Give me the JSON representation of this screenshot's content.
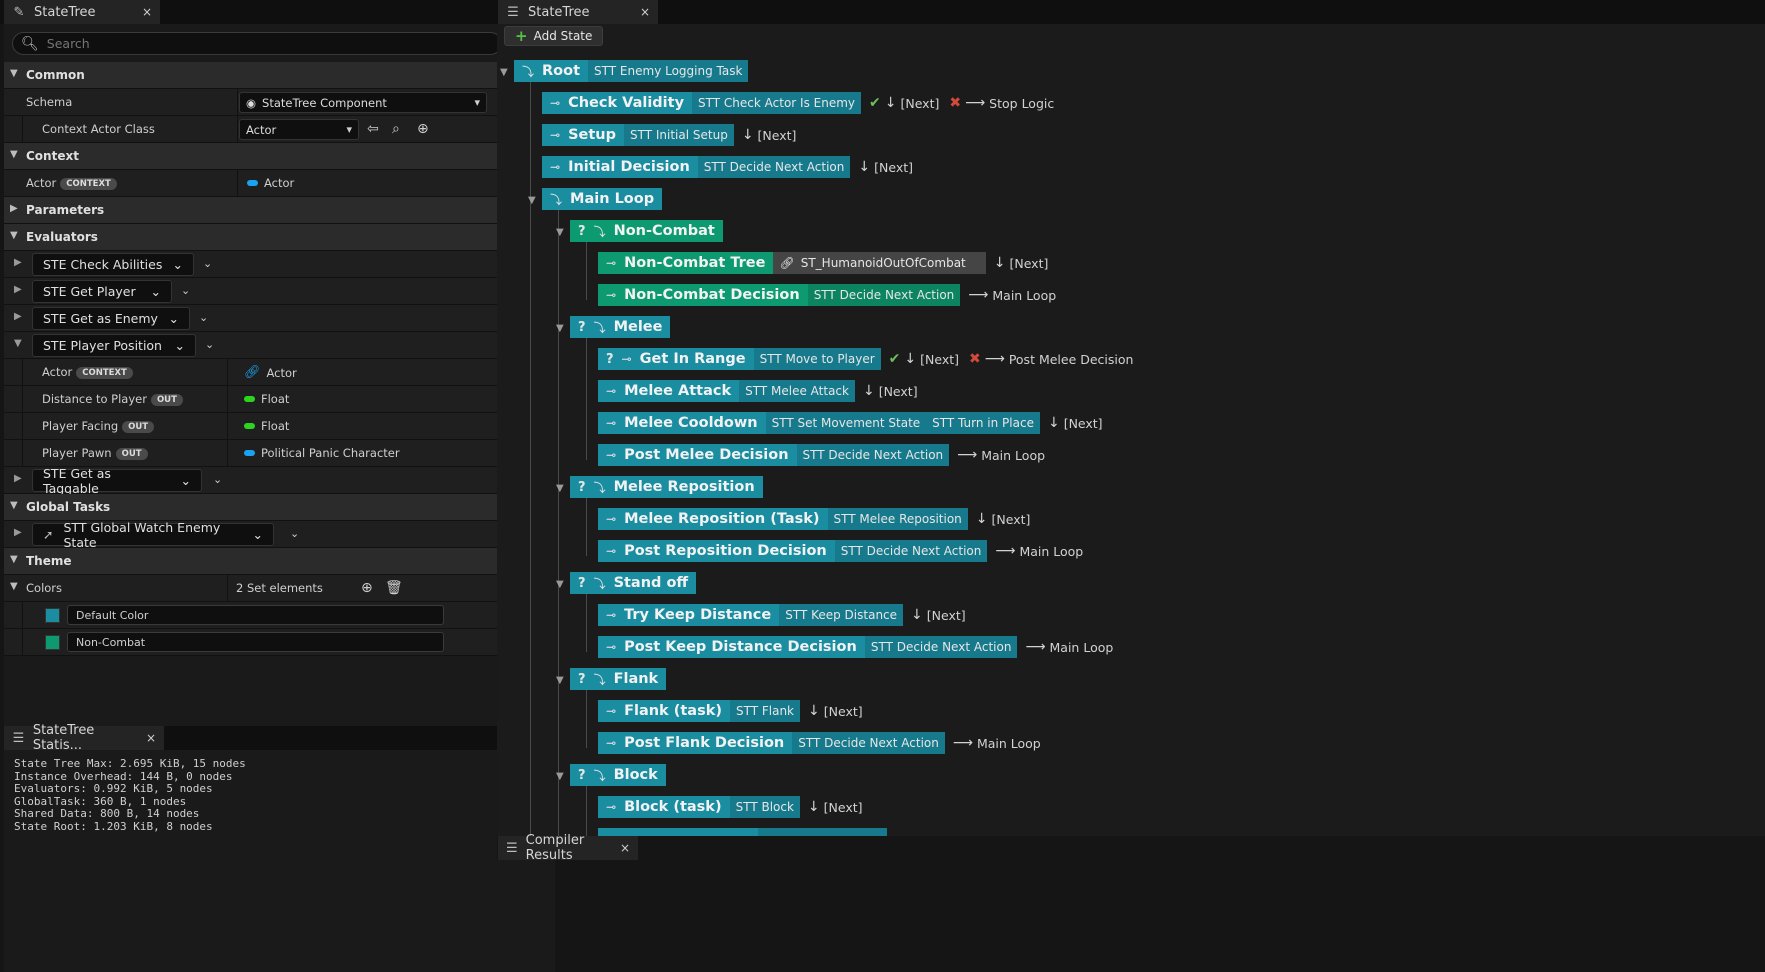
{
  "details_tab": {
    "title": "StateTree",
    "close": "×"
  },
  "search": {
    "placeholder": "Search"
  },
  "categories": {
    "common": "Common",
    "context": "Context",
    "parameters": "Parameters",
    "evaluators": "Evaluators",
    "global_tasks": "Global Tasks",
    "theme": "Theme"
  },
  "common": {
    "schema_label": "Schema",
    "schema_value": "StateTree Component",
    "context_actor_label": "Context Actor Class",
    "context_actor_value": "Actor"
  },
  "context": {
    "actor_label": "Actor",
    "badge": "CONTEXT",
    "actor_value": "Actor"
  },
  "evaluators": [
    {
      "name": "STE Check Abilities"
    },
    {
      "name": "STE Get Player"
    },
    {
      "name": "STE Get as Enemy"
    },
    {
      "name": "STE Player Position"
    },
    {
      "name": "STE Get as Taggable"
    }
  ],
  "player_position_props": [
    {
      "label": "Actor",
      "badge": "CONTEXT",
      "value": "Actor"
    },
    {
      "label": "Distance to Player",
      "badge": "OUT",
      "value": "Float"
    },
    {
      "label": "Player Facing",
      "badge": "OUT",
      "value": "Float"
    },
    {
      "label": "Player Pawn",
      "badge": "OUT",
      "value": "Political Panic Character"
    }
  ],
  "global_task": {
    "name": "STT Global Watch Enemy State"
  },
  "theme": {
    "colors_label": "Colors",
    "colors_value": "2 Set elements",
    "items": [
      {
        "name": "Default Color",
        "color": "#1b8da1"
      },
      {
        "name": "Non-Combat",
        "color": "#0e9a71"
      }
    ]
  },
  "stats_tab": {
    "title": "StateTree Statis...",
    "close": "×"
  },
  "stats_lines": [
    "State Tree Max: 2.695 KiB, 15 nodes",
    "Instance Overhead: 144 B, 0 nodes",
    "Evaluators: 0.992 KiB, 5 nodes",
    "GlobalTask: 360 B, 1 nodes",
    "Shared Data: 800 B, 14 nodes",
    "State Root: 1.203 KiB, 8 nodes"
  ],
  "tree_tab": {
    "title": "StateTree",
    "close": "×"
  },
  "add_state": "Add State",
  "compiler_tab": {
    "title": "Compiler Results",
    "close": "×"
  },
  "colors": {
    "state_teal": "#1b8da1",
    "state_green": "#0e9a71",
    "success": "#6ebf5a",
    "failure": "#d24a3a"
  },
  "states": [
    {
      "name": "Root",
      "tasks": [
        "STT Enemy Logging Task"
      ],
      "trans": []
    },
    {
      "name": "Check Validity",
      "tasks": [
        "STT Check Actor Is Enemy"
      ],
      "trans_ok": "[Next]",
      "trans_fail": "Stop Logic"
    },
    {
      "name": "Setup",
      "tasks": [
        "STT Initial Setup"
      ],
      "trans_next": "[Next]"
    },
    {
      "name": "Initial Decision",
      "tasks": [
        "STT Decide Next Action"
      ],
      "trans_next": "[Next]"
    },
    {
      "name": "Main Loop",
      "tasks": []
    },
    {
      "name": "Non-Combat",
      "tasks": []
    },
    {
      "name": "Non-Combat Tree",
      "tasks": [
        "ST_HumanoidOutOfCombat"
      ],
      "trans_next": "[Next]"
    },
    {
      "name": "Non-Combat Decision",
      "tasks": [
        "STT Decide Next Action"
      ],
      "trans_goto": "Main Loop"
    },
    {
      "name": "Melee",
      "tasks": []
    },
    {
      "name": "Get In Range",
      "tasks": [
        "STT Move to Player"
      ],
      "trans_ok": "[Next]",
      "trans_fail": "Post Melee Decision"
    },
    {
      "name": "Melee Attack",
      "tasks": [
        "STT Melee Attack"
      ],
      "trans_next": "[Next]"
    },
    {
      "name": "Melee Cooldown",
      "tasks": [
        "STT Set Movement State",
        "STT Turn in Place"
      ],
      "trans_next": "[Next]"
    },
    {
      "name": "Post Melee Decision",
      "tasks": [
        "STT Decide Next Action"
      ],
      "trans_goto": "Main Loop"
    },
    {
      "name": "Melee Reposition",
      "tasks": []
    },
    {
      "name": "Melee Reposition (Task)",
      "tasks": [
        "STT Melee Reposition"
      ],
      "trans_next": "[Next]"
    },
    {
      "name": "Post Reposition Decision",
      "tasks": [
        "STT Decide Next Action"
      ],
      "trans_goto": "Main Loop"
    },
    {
      "name": "Stand off",
      "tasks": []
    },
    {
      "name": "Try Keep Distance",
      "tasks": [
        "STT Keep Distance"
      ],
      "trans_next": "[Next]"
    },
    {
      "name": "Post Keep Distance Decision",
      "tasks": [
        "STT Decide Next Action"
      ],
      "trans_goto": "Main Loop"
    },
    {
      "name": "Flank",
      "tasks": []
    },
    {
      "name": "Flank (task)",
      "tasks": [
        "STT Flank"
      ],
      "trans_next": "[Next]"
    },
    {
      "name": "Post Flank Decision",
      "tasks": [
        "STT Decide Next Action"
      ],
      "trans_goto": "Main Loop"
    },
    {
      "name": "Block",
      "tasks": []
    },
    {
      "name": "Block (task)",
      "tasks": [
        "STT Block"
      ],
      "trans_next": "[Next]"
    }
  ]
}
